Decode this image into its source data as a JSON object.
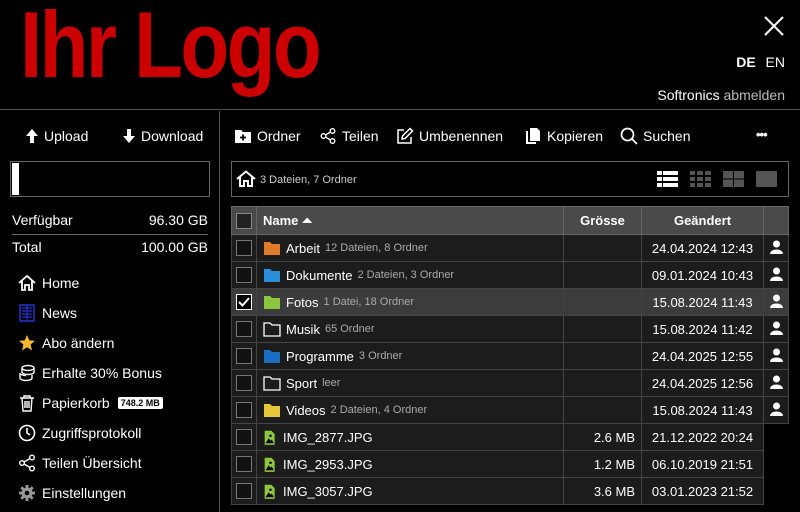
{
  "header": {
    "logo_text": "Ihr Logo",
    "lang_de": "DE",
    "lang_en": "EN",
    "username": "Softronics",
    "logout_label": "abmelden"
  },
  "sidebar": {
    "upload_label": "Upload",
    "download_label": "Download",
    "quota_used_fraction": 0.037,
    "available_label": "Verfügbar",
    "available_value": "96.30 GB",
    "total_label": "Total",
    "total_value": "100.00 GB",
    "nav": [
      {
        "label": "Home",
        "icon": "home-icon"
      },
      {
        "label": "News",
        "icon": "news-icon"
      },
      {
        "label": "Abo ändern",
        "icon": "star-icon"
      },
      {
        "label": "Erhalte 30% Bonus",
        "icon": "coins-icon"
      },
      {
        "label": "Papierkorb",
        "icon": "trash-icon",
        "badge": "748.2 MB"
      },
      {
        "label": "Zugriffsprotokoll",
        "icon": "clock-icon"
      },
      {
        "label": "Teilen Übersicht",
        "icon": "share-icon"
      },
      {
        "label": "Einstellungen",
        "icon": "gear-icon"
      }
    ]
  },
  "toolbar": {
    "folder_label": "Ordner",
    "share_label": "Teilen",
    "rename_label": "Umbenennen",
    "copy_label": "Kopieren",
    "search_label": "Suchen",
    "more_label": "•••"
  },
  "breadcrumb": {
    "info": "3 Dateien, 7 Ordner"
  },
  "table": {
    "col_name": "Name ⏶",
    "col_size": "Grösse",
    "col_changed": "Geändert",
    "rows": [
      {
        "name": "Arbeit",
        "meta": "12 Dateien, 8 Ordner",
        "size": "",
        "date": "24.04.2024 12:43",
        "type": "folder",
        "color": "#e07b2a",
        "checked": false,
        "shared": true
      },
      {
        "name": "Dokumente",
        "meta": "2 Dateien, 3 Ordner",
        "size": "",
        "date": "09.01.2024 10:43",
        "type": "folder",
        "color": "#2a8fd8",
        "checked": false,
        "shared": true
      },
      {
        "name": "Fotos",
        "meta": "1 Datei, 18 Ordner",
        "size": "",
        "date": "15.08.2024 11:43",
        "type": "folder",
        "color": "#8cc63f",
        "checked": true,
        "shared": true
      },
      {
        "name": "Musik",
        "meta": "65 Ordner",
        "size": "",
        "date": "15.08.2024 11:42",
        "type": "folder-outline",
        "color": "#ffffff",
        "checked": false,
        "shared": true
      },
      {
        "name": "Programme",
        "meta": "3 Ordner",
        "size": "",
        "date": "24.04.2025 12:55",
        "type": "folder",
        "color": "#1a6fc4",
        "checked": false,
        "shared": true
      },
      {
        "name": "Sport",
        "meta": "leer",
        "size": "",
        "date": "24.04.2025 12:56",
        "type": "folder-outline",
        "color": "#ffffff",
        "checked": false,
        "shared": true
      },
      {
        "name": "Videos",
        "meta": "2 Dateien, 4 Ordner",
        "size": "",
        "date": "15.08.2024 11:43",
        "type": "folder",
        "color": "#e8c63a",
        "checked": false,
        "shared": true
      },
      {
        "name": "IMG_2877.JPG",
        "meta": "",
        "size": "2.6 MB",
        "date": "21.12.2022 20:24",
        "type": "image",
        "color": "#8cc63f",
        "checked": false,
        "shared": false
      },
      {
        "name": "IMG_2953.JPG",
        "meta": "",
        "size": "1.2 MB",
        "date": "06.10.2019 21:51",
        "type": "image",
        "color": "#8cc63f",
        "checked": false,
        "shared": false
      },
      {
        "name": "IMG_3057.JPG",
        "meta": "",
        "size": "3.6 MB",
        "date": "03.01.2023 21:52",
        "type": "image",
        "color": "#8cc63f",
        "checked": false,
        "shared": false
      }
    ]
  },
  "colors": {
    "logo": "#cc0000",
    "header_bg": "#4a4a4a",
    "selected_row": "#3c3c3c"
  }
}
